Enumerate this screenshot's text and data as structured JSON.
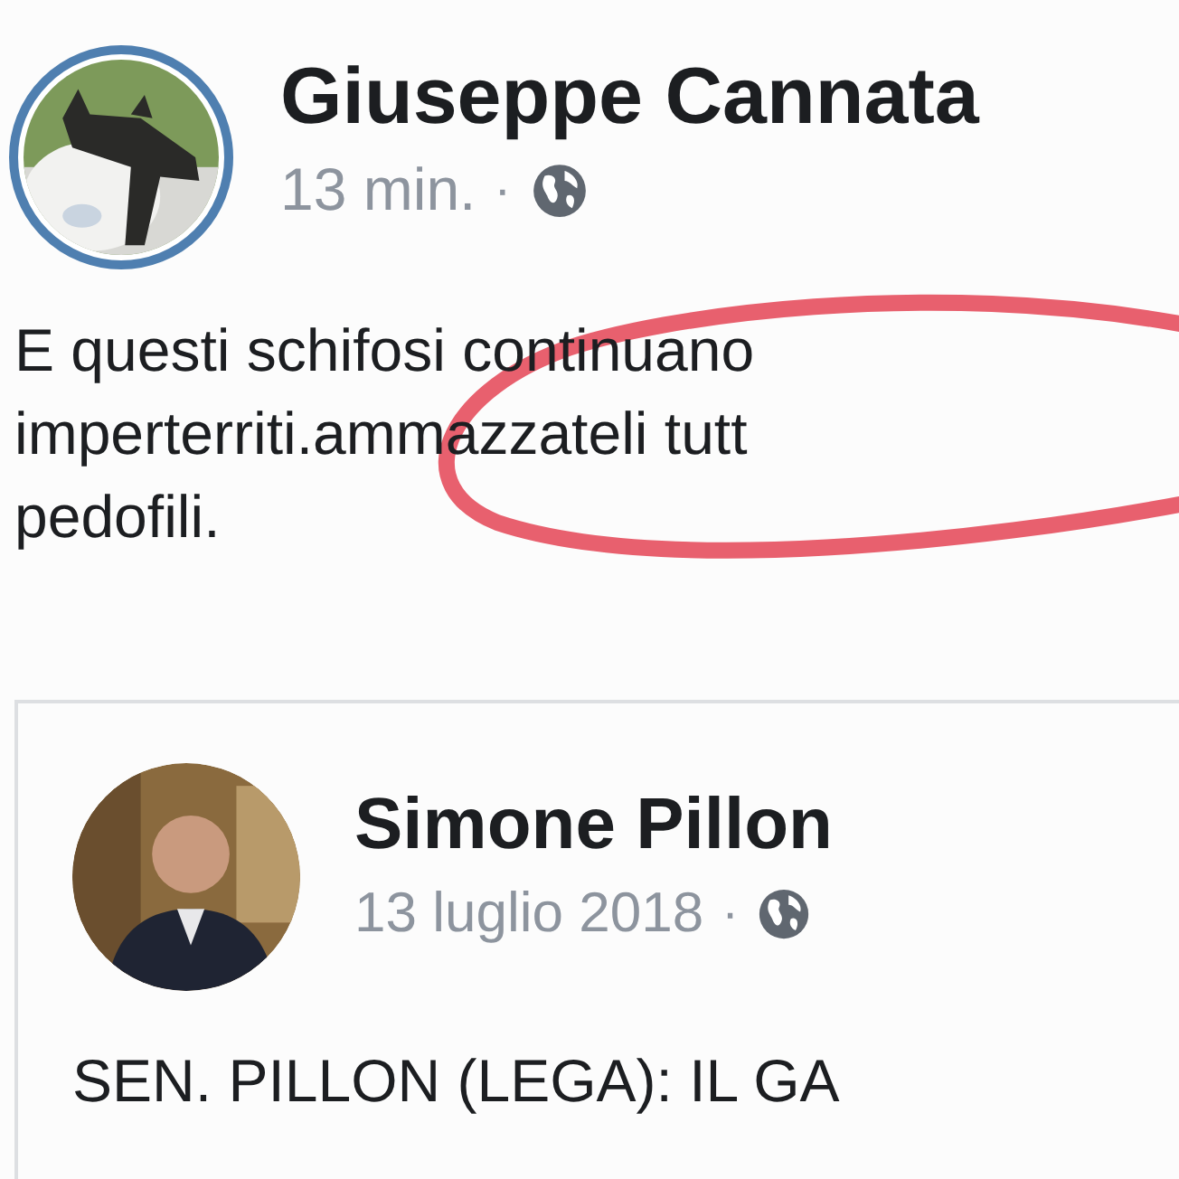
{
  "post": {
    "author": "Giuseppe Cannata",
    "time": "13 min.",
    "separator": "·",
    "body_lines": [
      "E questi schifosi continuano",
      "imperterriti.ammazzateli tutt",
      "pedofili."
    ],
    "annotation": {
      "kind": "ellipse",
      "color": "#e8606e"
    },
    "shared_post": {
      "author": "Simone Pillon",
      "time": "13 luglio 2018",
      "separator": "·",
      "headline": "SEN. PILLON (LEGA): IL GA"
    }
  }
}
